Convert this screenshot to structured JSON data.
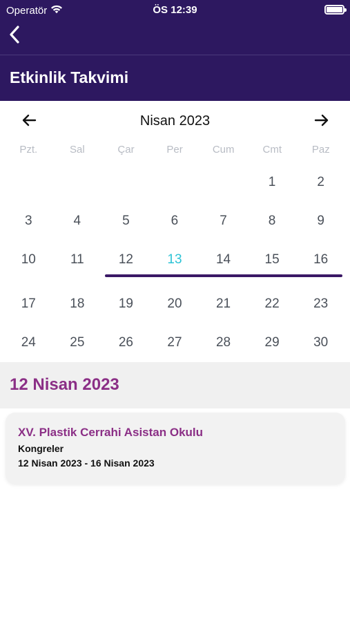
{
  "status": {
    "carrier": "Operatör",
    "time": "ÖS 12:39",
    "battery_level": 1.0
  },
  "nav": {
    "back_icon": "chevron-left-icon",
    "title": "Etkinlik Takvimi"
  },
  "calendar": {
    "month_label": "Nisan 2023",
    "prev_icon": "arrow-left-icon",
    "next_icon": "arrow-right-icon",
    "weekdays": [
      "Pzt.",
      "Sal",
      "Çar",
      "Per",
      "Cum",
      "Cmt",
      "Paz"
    ],
    "weeks": [
      [
        "",
        "",
        "",
        "",
        "",
        "1",
        "2"
      ],
      [
        "3",
        "4",
        "5",
        "6",
        "7",
        "8",
        "9"
      ],
      [
        "10",
        "11",
        "12",
        "13",
        "14",
        "15",
        "16"
      ],
      [
        "17",
        "18",
        "19",
        "20",
        "21",
        "22",
        "23"
      ],
      [
        "24",
        "25",
        "26",
        "27",
        "28",
        "29",
        "30"
      ]
    ],
    "today": "13",
    "range_start": "12",
    "range_end": "16",
    "colors": {
      "header_bg": "#2d1860",
      "range_line": "#3b1866",
      "today_text": "#2cc3d6",
      "accent": "#8b2f86"
    }
  },
  "selected": {
    "date_label": "12 Nisan 2023"
  },
  "event": {
    "title": "XV. Plastik Cerrahi Asistan Okulu",
    "category": "Kongreler",
    "dates": "12 Nisan 2023 - 16 Nisan 2023"
  }
}
